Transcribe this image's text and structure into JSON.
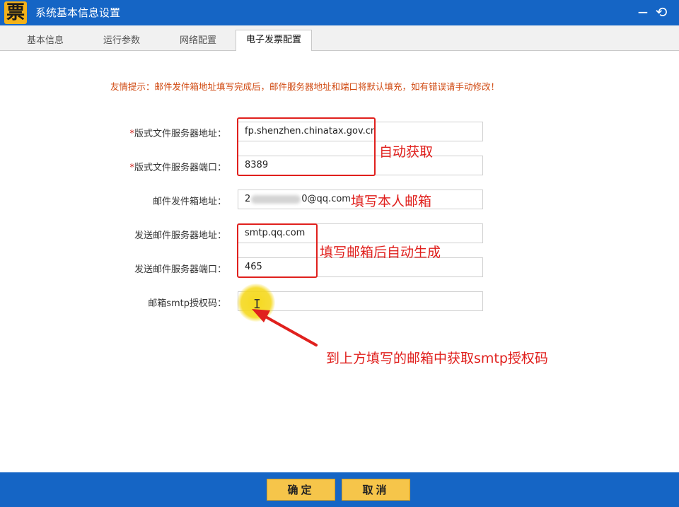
{
  "window": {
    "logo_char": "票",
    "title": "系统基本信息设置",
    "minimize_glyph": "−",
    "restore_glyph": "⟲"
  },
  "tabs": [
    {
      "label": "基本信息",
      "active": false
    },
    {
      "label": "运行参数",
      "active": false
    },
    {
      "label": "网络配置",
      "active": false
    },
    {
      "label": "电子发票配置",
      "active": true
    }
  ],
  "hint": "友情提示：邮件发件箱地址填写完成后，邮件服务器地址和端口将默认填充，如有错误请手动修改！",
  "form": {
    "layout_server_addr": {
      "label": "版式文件服务器地址：",
      "required": "*",
      "value": "fp.shenzhen.chinatax.gov.cn"
    },
    "layout_server_port": {
      "label": "版式文件服务器端口：",
      "required": "*",
      "value": "8389"
    },
    "sender_email": {
      "label": "邮件发件箱地址：",
      "value_prefix": "2",
      "value_suffix": "0@qq.com"
    },
    "smtp_server_addr": {
      "label": "发送邮件服务器地址：",
      "value": "smtp.qq.com"
    },
    "smtp_server_port": {
      "label": "发送邮件服务器端口：",
      "value": "465"
    },
    "smtp_auth_code": {
      "label": "邮箱smtp授权码：",
      "value": ""
    }
  },
  "annotations": {
    "auto_get": "自动获取",
    "fill_own_email": "填写本人邮箱",
    "auto_generate": "填写邮箱后自动生成",
    "get_smtp_code": "到上方填写的邮箱中获取smtp授权码"
  },
  "footer": {
    "confirm_label": "确定",
    "cancel_label": "取消"
  },
  "colors": {
    "titlebar": "#1565c5",
    "annotation_red": "#e0201d",
    "button_yellow": "#f6c54a",
    "hint_orange": "#d04a12"
  }
}
